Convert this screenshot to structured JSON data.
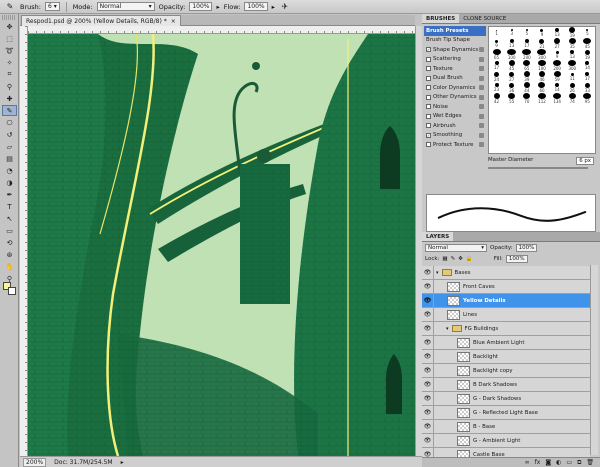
{
  "options_bar": {
    "brush_label": "Brush:",
    "brush_size": "6",
    "mode_label": "Mode:",
    "mode_value": "Normal",
    "opacity_label": "Opacity:",
    "opacity_value": "100%",
    "flow_label": "Flow:",
    "flow_value": "100%"
  },
  "document": {
    "tab_title": "Respod1.psd @ 200% (Yellow Details, RGB/8) *",
    "close_icon": "×"
  },
  "status": {
    "zoom": "200%",
    "doc_info": "Doc: 31.7M/254.5M"
  },
  "brushes_panel": {
    "tabs": [
      "BRUSHES",
      "CLONE SOURCE"
    ],
    "items": [
      {
        "label": "Brush Presets",
        "checkbox": false,
        "checked": false,
        "selected": true
      },
      {
        "label": "Brush Tip Shape",
        "checkbox": false,
        "checked": false,
        "selected": false
      },
      {
        "label": "Shape Dynamics",
        "checkbox": true,
        "checked": true,
        "selected": false
      },
      {
        "label": "Scattering",
        "checkbox": true,
        "checked": false,
        "selected": false
      },
      {
        "label": "Texture",
        "checkbox": true,
        "checked": false,
        "selected": false
      },
      {
        "label": "Dual Brush",
        "checkbox": true,
        "checked": false,
        "selected": false
      },
      {
        "label": "Color Dynamics",
        "checkbox": true,
        "checked": false,
        "selected": false
      },
      {
        "label": "Other Dynamics",
        "checkbox": true,
        "checked": false,
        "selected": false
      },
      {
        "label": "Noise",
        "checkbox": true,
        "checked": false,
        "selected": false
      },
      {
        "label": "Wet Edges",
        "checkbox": true,
        "checked": false,
        "selected": false
      },
      {
        "label": "Airbrush",
        "checkbox": true,
        "checked": false,
        "selected": false
      },
      {
        "label": "Smoothing",
        "checkbox": true,
        "checked": true,
        "selected": false
      },
      {
        "label": "Protect Texture",
        "checkbox": true,
        "checked": false,
        "selected": false
      }
    ],
    "presets": [
      {
        "size": "1",
        "dot": 1
      },
      {
        "size": "3",
        "dot": 2
      },
      {
        "size": "5",
        "dot": 2
      },
      {
        "size": "9",
        "dot": 3
      },
      {
        "size": "13",
        "dot": 4
      },
      {
        "size": "19",
        "dot": 6
      },
      {
        "size": "5",
        "dot": 2
      },
      {
        "size": "9",
        "dot": 3
      },
      {
        "size": "13",
        "dot": 4
      },
      {
        "size": "17",
        "dot": 4
      },
      {
        "size": "21",
        "dot": 5
      },
      {
        "size": "27",
        "dot": 6
      },
      {
        "size": "35",
        "dot": 7
      },
      {
        "size": "45",
        "dot": 8
      },
      {
        "size": "65",
        "dot": 8
      },
      {
        "size": "100",
        "dot": 9
      },
      {
        "size": "200",
        "dot": 9
      },
      {
        "size": "300",
        "dot": 9
      },
      {
        "size": "9",
        "dot": 3
      },
      {
        "size": "13",
        "dot": 4
      },
      {
        "size": "19",
        "dot": 5
      },
      {
        "size": "17",
        "dot": 4
      },
      {
        "size": "45",
        "dot": 6
      },
      {
        "size": "65",
        "dot": 7
      },
      {
        "size": "100",
        "dot": 8
      },
      {
        "size": "200",
        "dot": 8
      },
      {
        "size": "300",
        "dot": 8
      },
      {
        "size": "14",
        "dot": 4
      },
      {
        "size": "24",
        "dot": 5
      },
      {
        "size": "27",
        "dot": 5
      },
      {
        "size": "39",
        "dot": 6
      },
      {
        "size": "46",
        "dot": 6
      },
      {
        "size": "59",
        "dot": 7
      },
      {
        "size": "11",
        "dot": 3
      },
      {
        "size": "17",
        "dot": 4
      },
      {
        "size": "23",
        "dot": 4
      },
      {
        "size": "36",
        "dot": 5
      },
      {
        "size": "44",
        "dot": 6
      },
      {
        "size": "60",
        "dot": 7
      },
      {
        "size": "14",
        "dot": 4
      },
      {
        "size": "26",
        "dot": 5
      },
      {
        "size": "33",
        "dot": 5
      },
      {
        "size": "42",
        "dot": 6
      },
      {
        "size": "55",
        "dot": 7
      },
      {
        "size": "70",
        "dot": 7
      },
      {
        "size": "112",
        "dot": 8
      },
      {
        "size": "134",
        "dot": 8
      },
      {
        "size": "74",
        "dot": 7
      },
      {
        "size": "95",
        "dot": 8
      }
    ],
    "master_diameter_label": "Master Diameter",
    "master_diameter_value": "6 px"
  },
  "layers_panel": {
    "tab": "LAYERS",
    "blend_mode": "Normal",
    "opacity_label": "Opacity:",
    "opacity_value": "100%",
    "lock_label": "Lock:",
    "fill_label": "Fill:",
    "fill_value": "100%",
    "layers": [
      {
        "name": "Bases",
        "kind": "group",
        "indent": 0,
        "selected": false
      },
      {
        "name": "Front Caves",
        "kind": "layer",
        "indent": 1,
        "selected": false
      },
      {
        "name": "Yellow Details",
        "kind": "layer",
        "indent": 1,
        "selected": true
      },
      {
        "name": "Lines",
        "kind": "layer",
        "indent": 1,
        "selected": false
      },
      {
        "name": "FG Buildings",
        "kind": "group",
        "indent": 1,
        "selected": false
      },
      {
        "name": "Blue Ambient Light",
        "kind": "layer",
        "indent": 2,
        "selected": false
      },
      {
        "name": "Backlight",
        "kind": "layer",
        "indent": 2,
        "selected": false
      },
      {
        "name": "Backlight copy",
        "kind": "layer",
        "indent": 2,
        "selected": false
      },
      {
        "name": "B Dark Shadows",
        "kind": "layer",
        "indent": 2,
        "selected": false
      },
      {
        "name": "G - Dark Shadows",
        "kind": "layer",
        "indent": 2,
        "selected": false
      },
      {
        "name": "G - Reflected Light Base",
        "kind": "layer",
        "indent": 2,
        "selected": false
      },
      {
        "name": "B - Base",
        "kind": "layer",
        "indent": 2,
        "selected": false
      },
      {
        "name": "G - Ambient Light",
        "kind": "layer",
        "indent": 2,
        "selected": false
      },
      {
        "name": "Castle Base",
        "kind": "layer",
        "indent": 2,
        "selected": false
      }
    ],
    "eye_icon": "👁"
  },
  "colors": {
    "foreground": "#f7f59a",
    "background": "#ffffff",
    "selection": "#3f93ea"
  }
}
